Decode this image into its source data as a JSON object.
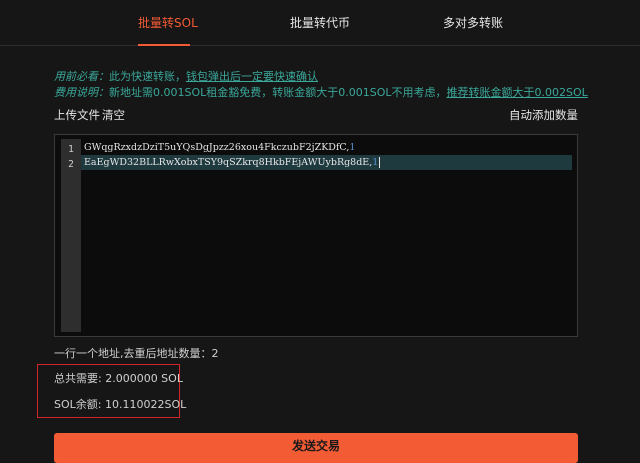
{
  "tabs": [
    {
      "label": "批量转SOL",
      "active": true
    },
    {
      "label": "批量转代币",
      "active": false
    },
    {
      "label": "多对多转账",
      "active": false
    }
  ],
  "notice": {
    "must_read_label": "用前必看：",
    "must_read_text": "此为快速转账，",
    "must_read_link": "钱包弹出后一定要快速确认",
    "fee_label": "费用说明：",
    "fee_text": "新地址需0.001SOL租金豁免费，转账金额大于0.001SOL不用考虑，",
    "fee_link": "推荐转账金额大于0.002SOL"
  },
  "toolbar": {
    "upload_label": "上传文件",
    "clear_label": "清空",
    "auto_add_label": "自动添加数量"
  },
  "editor": {
    "lines": [
      {
        "number": "1",
        "address": "GWqgRzxdzDziT5uYQsDgJpzz26xou4FkczubF2jZKDfC,",
        "amount": "1"
      },
      {
        "number": "2",
        "address": "EaEgWD32BLLRwXobxTSY9qSZkrq8HkbFEjAWUybRg8dE,",
        "amount": "1"
      }
    ]
  },
  "count_line": "一行一个地址,去重后地址数量：2",
  "summary": {
    "total_needed": "总共需要: 2.000000 SOL",
    "balance": "SOL余额: 10.110022SOL"
  },
  "send_button": "发送交易",
  "colors": {
    "accent": "#f35b34",
    "notice": "#3aa89a",
    "highlight_border": "#d0262a"
  }
}
